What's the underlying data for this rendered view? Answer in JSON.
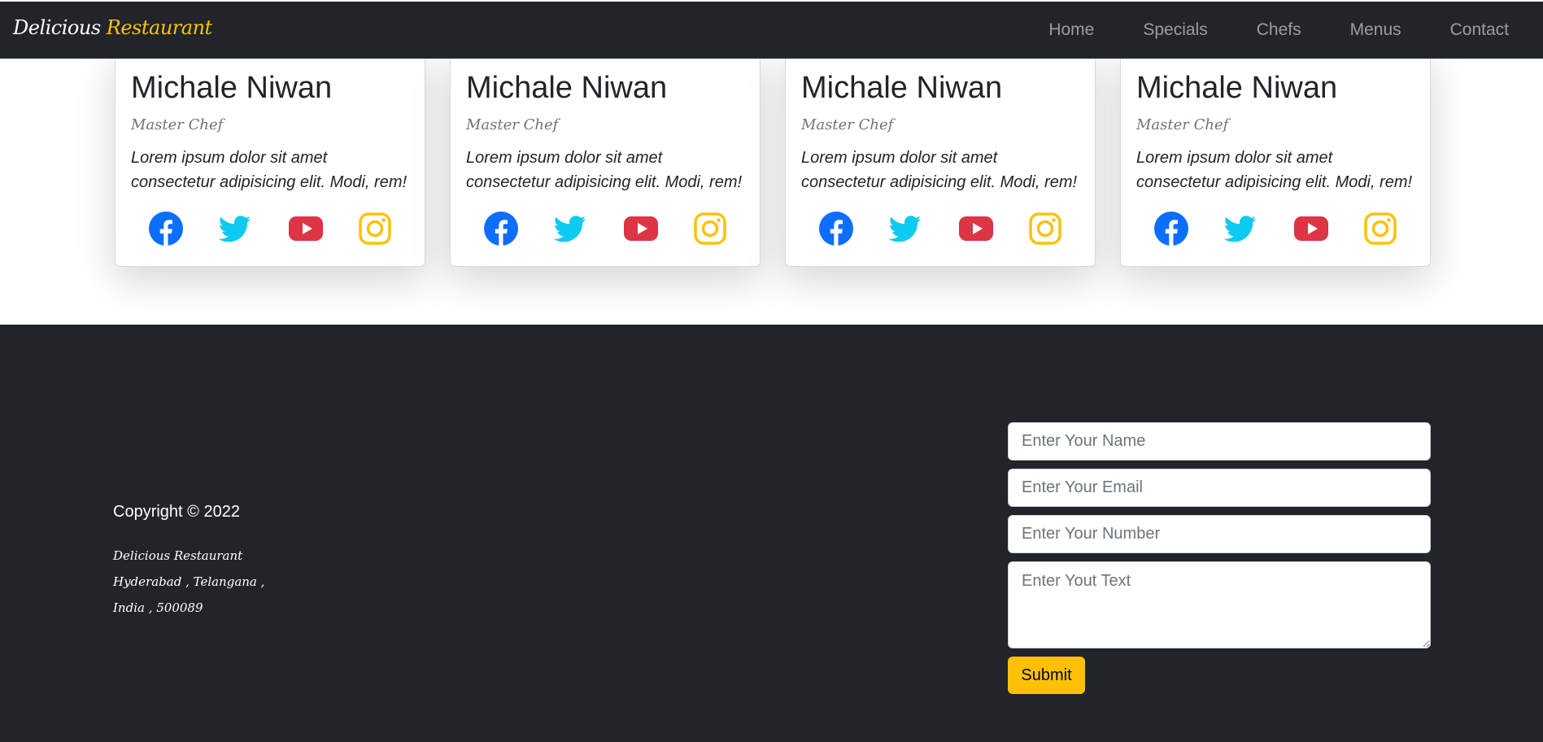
{
  "navbar": {
    "brand_main": "Delicious",
    "brand_accent": "Restaurant",
    "links": [
      "Home",
      "Specials",
      "Chefs",
      "Menus",
      "Contact"
    ]
  },
  "chefs": [
    {
      "name": "Michale Niwan",
      "role": "Master Chef",
      "bio": "Lorem ipsum dolor sit amet consectetur adipisicing elit. Modi, rem!"
    },
    {
      "name": "Michale Niwan",
      "role": "Master Chef",
      "bio": "Lorem ipsum dolor sit amet consectetur adipisicing elit. Modi, rem!"
    },
    {
      "name": "Michale Niwan",
      "role": "Master Chef",
      "bio": "Lorem ipsum dolor sit amet consectetur adipisicing elit. Modi, rem!"
    },
    {
      "name": "Michale Niwan",
      "role": "Master Chef",
      "bio": "Lorem ipsum dolor sit amet consectetur adipisicing elit. Modi, rem!"
    }
  ],
  "social_icons": [
    "facebook-icon",
    "twitter-icon",
    "youtube-icon",
    "instagram-icon"
  ],
  "colors": {
    "accent": "#ffc107",
    "facebook": "#0d6efd",
    "twitter": "#0dcaf0",
    "youtube": "#dc3545",
    "instagram": "#ffc107",
    "dark": "#212529"
  },
  "footer": {
    "copyright": "Copyright © 2022",
    "address_line1": "Delicious Restaurant",
    "address_line2": "Hyderabad , Telangana ,",
    "address_line3": "India , 500089"
  },
  "form": {
    "name_placeholder": "Enter Your Name",
    "email_placeholder": "Enter Your Email",
    "number_placeholder": "Enter Your Number",
    "text_placeholder": "Enter Yout Text",
    "submit_label": "Submit"
  }
}
